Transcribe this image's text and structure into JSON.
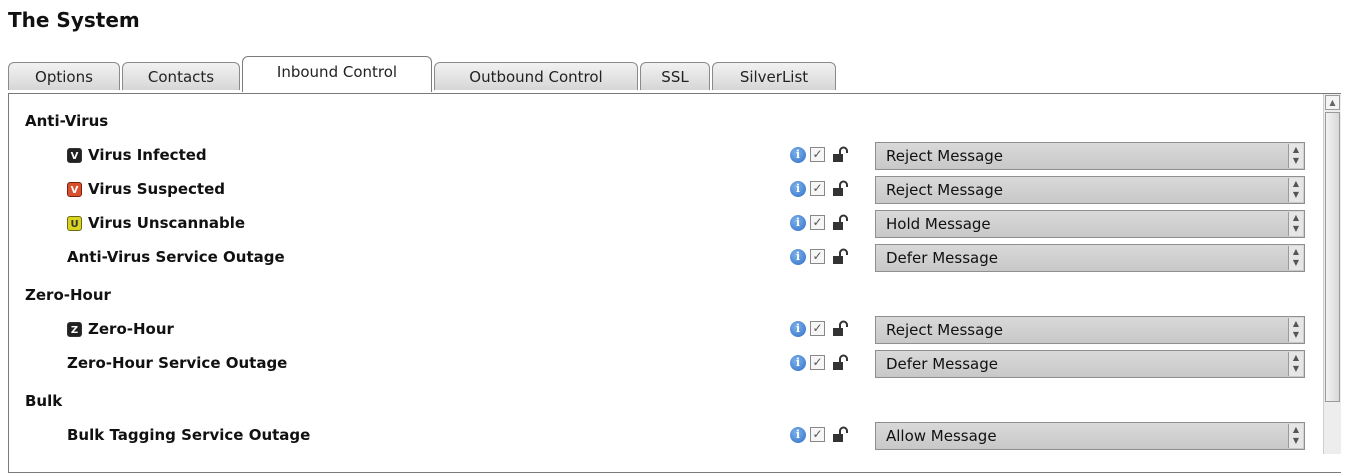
{
  "page": {
    "title": "The System"
  },
  "tabs": [
    {
      "label": "Options"
    },
    {
      "label": "Contacts"
    },
    {
      "label": "Inbound Control",
      "active": true
    },
    {
      "label": "Outbound Control"
    },
    {
      "label": "SSL"
    },
    {
      "label": "SilverList"
    }
  ],
  "sections": [
    {
      "label": "Anti-Virus",
      "items": [
        {
          "label": "Virus Infected",
          "badge": "V",
          "badge_color": "#222222",
          "action": "Reject Message"
        },
        {
          "label": "Virus Suspected",
          "badge": "V",
          "badge_color": "#d8502e",
          "action": "Reject Message"
        },
        {
          "label": "Virus Unscannable",
          "badge": "U",
          "badge_color": "#d9d322",
          "action": "Hold Message"
        },
        {
          "label": "Anti-Virus Service Outage",
          "action": "Defer Message"
        }
      ]
    },
    {
      "label": "Zero-Hour",
      "items": [
        {
          "label": "Zero-Hour",
          "badge": "Z",
          "badge_color": "#222222",
          "action": "Reject Message"
        },
        {
          "label": "Zero-Hour Service Outage",
          "action": "Defer Message"
        }
      ]
    },
    {
      "label": "Bulk",
      "items": [
        {
          "label": "Bulk Tagging Service Outage",
          "action": "Allow Message"
        }
      ]
    }
  ],
  "icons": {
    "info": "info-icon",
    "check": "checkbox-icon",
    "lock": "unlock-icon"
  }
}
